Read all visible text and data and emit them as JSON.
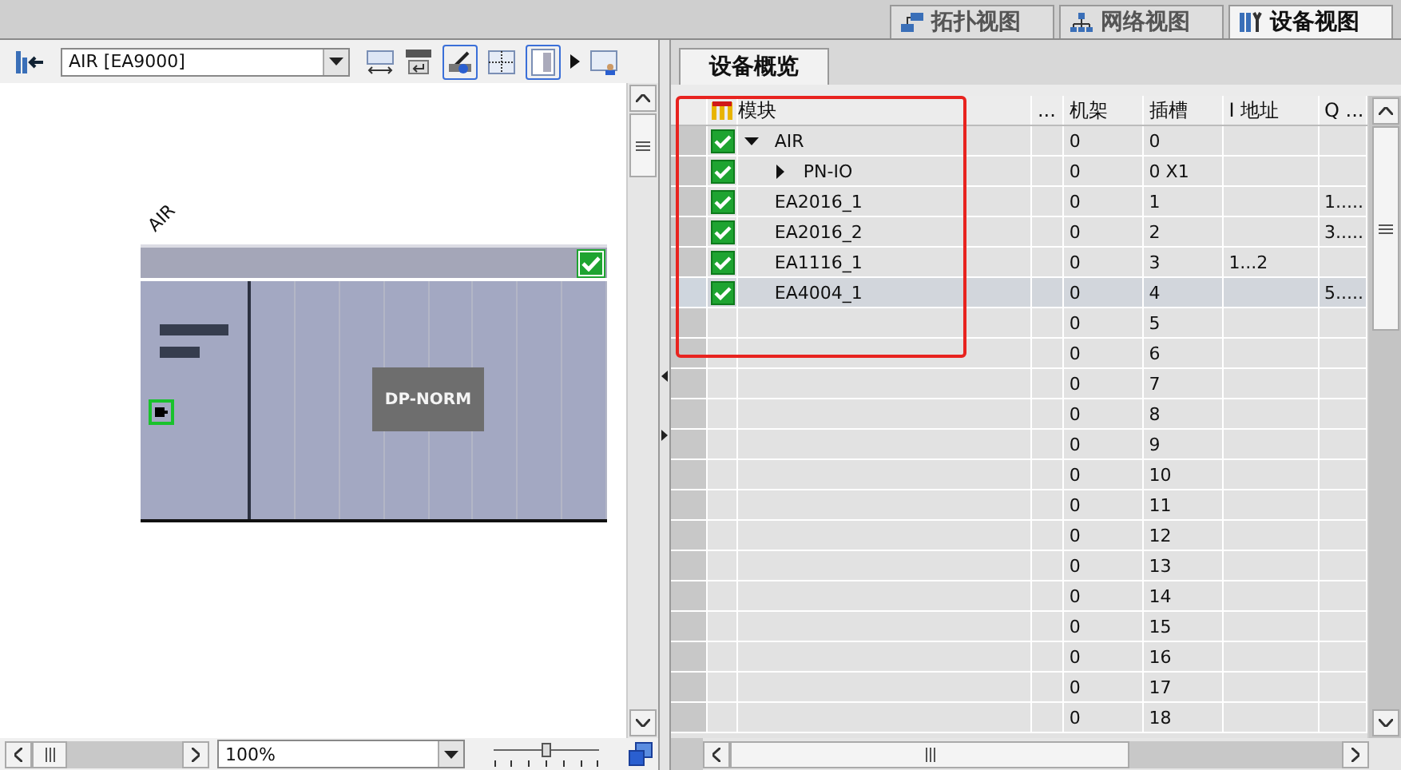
{
  "view_tabs": [
    {
      "label": "拓扑视图",
      "selected": false
    },
    {
      "label": "网络视图",
      "selected": false
    },
    {
      "label": "设备视图",
      "selected": true
    }
  ],
  "toolbar": {
    "device_select": "AIR [EA9000]"
  },
  "canvas": {
    "device_label": "AIR",
    "module_label": "DP-NORM",
    "status_checked": true
  },
  "bottom_bar": {
    "zoom": "100%",
    "zoom_slider": {
      "level": 0.5
    }
  },
  "overview_tab": {
    "label": "设备概览",
    "selected": true
  },
  "table": {
    "columns": [
      "模块",
      "...",
      "机架",
      "插槽",
      "I 地址",
      "Q ..."
    ],
    "rows": [
      {
        "module": "AIR",
        "checked": true,
        "expanded": true,
        "selected": false,
        "rack": "0",
        "slot": "0",
        "children": [
          {
            "module": "PN-IO",
            "checked": true,
            "expanded": false,
            "selected": false,
            "rack": "0",
            "slot": "0 X1"
          }
        ]
      },
      {
        "module": "EA2016_1",
        "checked": true,
        "selected": false,
        "rack": "0",
        "slot": "1",
        "q_address": "1....."
      },
      {
        "module": "EA2016_2",
        "checked": true,
        "selected": false,
        "rack": "0",
        "slot": "2",
        "q_address": "3....."
      },
      {
        "module": "EA1116_1",
        "checked": true,
        "selected": false,
        "rack": "0",
        "slot": "3",
        "i_address": "1...2"
      },
      {
        "module": "EA4004_1",
        "checked": true,
        "selected": true,
        "rack": "0",
        "slot": "4",
        "q_address": "5....."
      },
      {
        "rack": "0",
        "slot": "5"
      },
      {
        "rack": "0",
        "slot": "6"
      },
      {
        "rack": "0",
        "slot": "7"
      },
      {
        "rack": "0",
        "slot": "8"
      },
      {
        "rack": "0",
        "slot": "9"
      },
      {
        "rack": "0",
        "slot": "10"
      },
      {
        "rack": "0",
        "slot": "11"
      },
      {
        "rack": "0",
        "slot": "12"
      },
      {
        "rack": "0",
        "slot": "13"
      },
      {
        "rack": "0",
        "slot": "14"
      },
      {
        "rack": "0",
        "slot": "15"
      },
      {
        "rack": "0",
        "slot": "16"
      },
      {
        "rack": "0",
        "slot": "17"
      },
      {
        "rack": "0",
        "slot": "18"
      }
    ]
  }
}
